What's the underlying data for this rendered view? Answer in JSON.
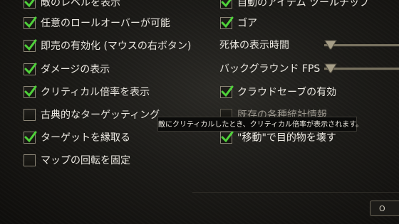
{
  "left_options": [
    {
      "label": "敵のレベルを表示",
      "checked": true
    },
    {
      "label": "任意のロールオーバーが可能",
      "checked": true
    },
    {
      "label": "即売の有効化 (マウスの右ボタン)",
      "checked": true
    },
    {
      "label": "ダメージの表示",
      "checked": true
    },
    {
      "label": "クリティカル倍率を表示",
      "checked": true
    },
    {
      "label": "古典的なターゲッティング",
      "checked": false
    },
    {
      "label": "ターゲットを縁取る",
      "checked": true
    },
    {
      "label": "マップの回転を固定",
      "checked": false
    }
  ],
  "right_options": {
    "auto_item": {
      "label": "自動のアイテム ツールチップ",
      "checked": true
    },
    "gore": {
      "label": "ゴア",
      "checked": true
    },
    "cloud_save": {
      "label": "クラウドセーブの有効",
      "checked": true
    },
    "hidden_row": {
      "label": "既存の各種統計情報",
      "checked": false
    },
    "move": {
      "label": "\"移動\"で目的物を壊す",
      "checked": true
    }
  },
  "sliders": {
    "corpse": {
      "label": "死体の表示時間"
    },
    "bg_fps": {
      "label": "バックグラウンド FPS"
    }
  },
  "tooltip": {
    "text": "敵にクリティカルしたとき、クリティカル倍率が表示されます。"
  },
  "bottom_button": {
    "label": "O"
  }
}
